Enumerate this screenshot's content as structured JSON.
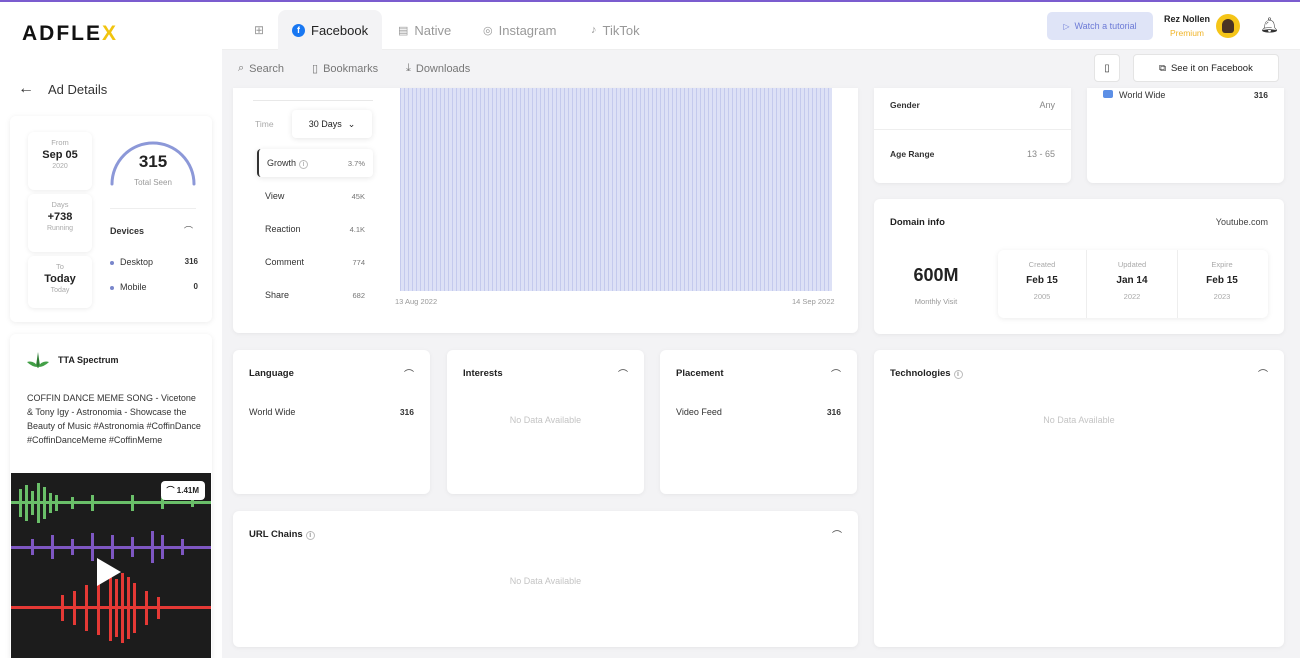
{
  "app": {
    "logo_left": "ADFLE",
    "logo_x": "X"
  },
  "nav": {
    "back_label": "Ad Details",
    "tabs": [
      {
        "label": "Facebook"
      },
      {
        "label": "Native"
      },
      {
        "label": "Instagram"
      },
      {
        "label": "TikTok"
      }
    ],
    "subtabs": [
      {
        "label": "Search"
      },
      {
        "label": "Bookmarks"
      },
      {
        "label": "Downloads"
      }
    ],
    "tutorial_label": "Watch a tutorial",
    "see_on_facebook": "See it on Facebook"
  },
  "user": {
    "name": "Rez Nollen",
    "tier": "Premium"
  },
  "stats": {
    "from_label": "From",
    "from_value": "Sep 05",
    "from_sub": "2020",
    "days_label": "Days",
    "days_value": "+738",
    "days_sub": "Running",
    "to_label": "To",
    "to_value": "Today",
    "to_sub": "Today",
    "total_seen": "315",
    "total_seen_label": "Total Seen",
    "devices_title": "Devices",
    "devices": [
      {
        "name": "Desktop",
        "count": "316"
      },
      {
        "name": "Mobile",
        "count": "0"
      }
    ]
  },
  "advertiser": {
    "name": "TTA Spectrum",
    "description": "COFFIN DANCE MEME SONG - Vicetone & Tony Igy - Astronomia - Showcase the Beauty of Music #Astronomia #CoffinDance #CoffinDanceMeme #CoffinMeme",
    "views": "1.41M"
  },
  "engagement": {
    "time_label": "Time",
    "time_value": "30 Days",
    "metrics": [
      {
        "name": "Growth",
        "value": "3.7%"
      },
      {
        "name": "View",
        "value": "45K"
      },
      {
        "name": "Reaction",
        "value": "4.1K"
      },
      {
        "name": "Comment",
        "value": "774"
      },
      {
        "name": "Share",
        "value": "682"
      }
    ],
    "date_start": "13 Aug 2022",
    "date_end": "14 Sep 2022"
  },
  "audience": {
    "gender_label": "Gender",
    "gender_value": "Any",
    "age_label": "Age Range",
    "age_value": "13 - 65",
    "region_label": "World Wide",
    "region_value": "316"
  },
  "domain": {
    "title": "Domain info",
    "name": "Youtube.com",
    "visits": "600M",
    "visits_label": "Monthly Visit",
    "created_label": "Created",
    "created_value": "Feb 15",
    "created_year": "2005",
    "updated_label": "Updated",
    "updated_value": "Jan 14",
    "updated_year": "2022",
    "expire_label": "Expire",
    "expire_value": "Feb 15",
    "expire_year": "2023"
  },
  "language": {
    "title": "Language",
    "item": "World Wide",
    "value": "316"
  },
  "interests": {
    "title": "Interests",
    "empty": "No Data Available"
  },
  "placement": {
    "title": "Placement",
    "item": "Video Feed",
    "value": "316"
  },
  "technologies": {
    "title": "Technologies",
    "empty": "No Data Available"
  },
  "url_chains": {
    "title": "URL Chains",
    "empty": "No Data Available"
  },
  "colors": {
    "accent": "#7986cb",
    "premium": "#f0b429",
    "facebook": "#1877f2"
  },
  "icons": [
    "grid-icon",
    "facebook-icon",
    "native-icon",
    "instagram-icon",
    "tiktok-icon",
    "play-icon",
    "bell-icon",
    "search-icon",
    "bookmark-icon",
    "download-icon",
    "external-link-icon",
    "eye-icon",
    "info-icon",
    "back-arrow-icon"
  ]
}
